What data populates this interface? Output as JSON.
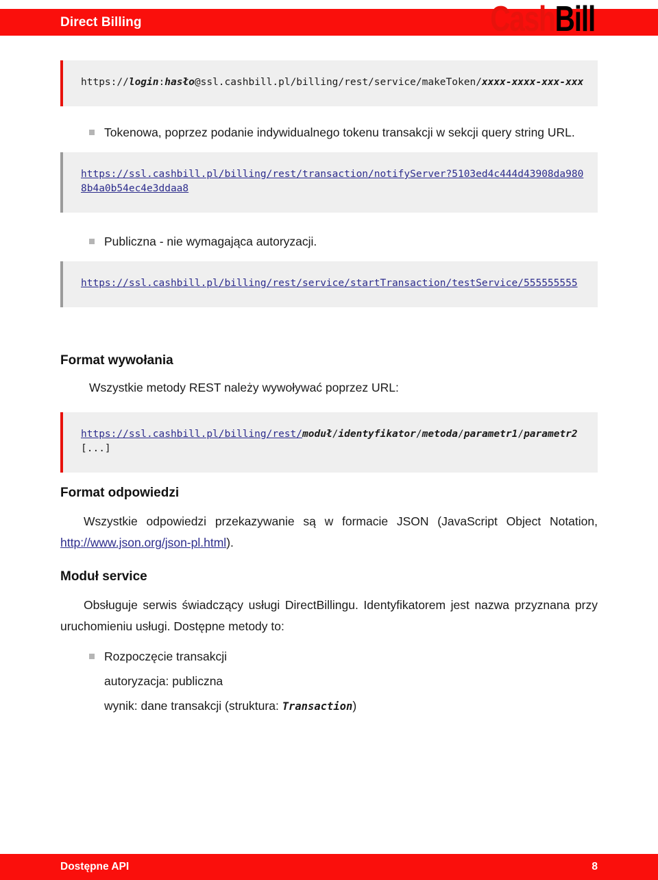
{
  "header": {
    "title": "Direct Billing",
    "logo": {
      "part1": "Cash",
      "part2": "Bill"
    },
    "bar_color": "#fa0f0c",
    "logo_color_primary": "#e8120c",
    "logo_color_secondary": "#000000"
  },
  "blocks": {
    "make_token": {
      "accent": "red",
      "segments": {
        "s1": "https://",
        "s2": "login",
        "s3": ":",
        "s4": "hasło",
        "s5": "@ssl.cashbill.pl/billing/rest/service/makeToken/",
        "s6": "xxxx-xxxx-xxx-xxx"
      }
    },
    "notify_server": {
      "accent": "gray",
      "link": "https://ssl.cashbill.pl/billing/rest/transaction/notifyServer?5103ed4c444d43908da9808b4a0b54ec4e3ddaa8"
    },
    "start_transaction": {
      "accent": "gray",
      "link": "https://ssl.cashbill.pl/billing/rest/service/startTransaction/testService/555555555"
    },
    "url_template": {
      "accent": "red",
      "segments": {
        "base": "https://ssl.cashbill.pl/billing/rest/",
        "modul": "moduł",
        "sep1": "/",
        "identyfikator": "identyfikator",
        "sep2": "/",
        "metoda": "metoda",
        "sep3": "/",
        "parametr1": "parametr1",
        "sep4": "/",
        "parametr2": "parametr2",
        "tail": "[...]"
      }
    }
  },
  "bullets": {
    "tokenowa": "Tokenowa, poprzez podanie indywidualnego tokenu transakcji w sekcji query string URL.",
    "publiczna": "Publiczna - nie wymagająca autoryzacji.",
    "rozpoczecie": "Rozpoczęcie transakcji"
  },
  "sections": {
    "format_wywolania": {
      "heading": "Format wywołania",
      "intro": "Wszystkie metody REST należy wywoływać poprzez URL:"
    },
    "format_odpowiedzi": {
      "heading": "Format odpowiedzi",
      "text_before": "Wszystkie odpowiedzi przekazywanie są w formacie JSON (JavaScript Object Notation, ",
      "link_text": "http://www.json.org/json-pl.html",
      "text_after": ")."
    },
    "modul_service": {
      "heading": "Moduł service",
      "paragraph": "Obsługuje serwis świadczący usługi DirectBillingu. Identyfikatorem jest nazwa przyznana przy uruchomieniu usługi. Dostępne metody to:",
      "method_auth": "autoryzacja: publiczna",
      "method_result_before": "wynik: dane transakcji (struktura: ",
      "method_result_struct": "Transaction",
      "method_result_after": ")"
    }
  },
  "footer": {
    "label": "Dostępne API",
    "page_number": "8",
    "bar_color": "#fa0f0c"
  }
}
